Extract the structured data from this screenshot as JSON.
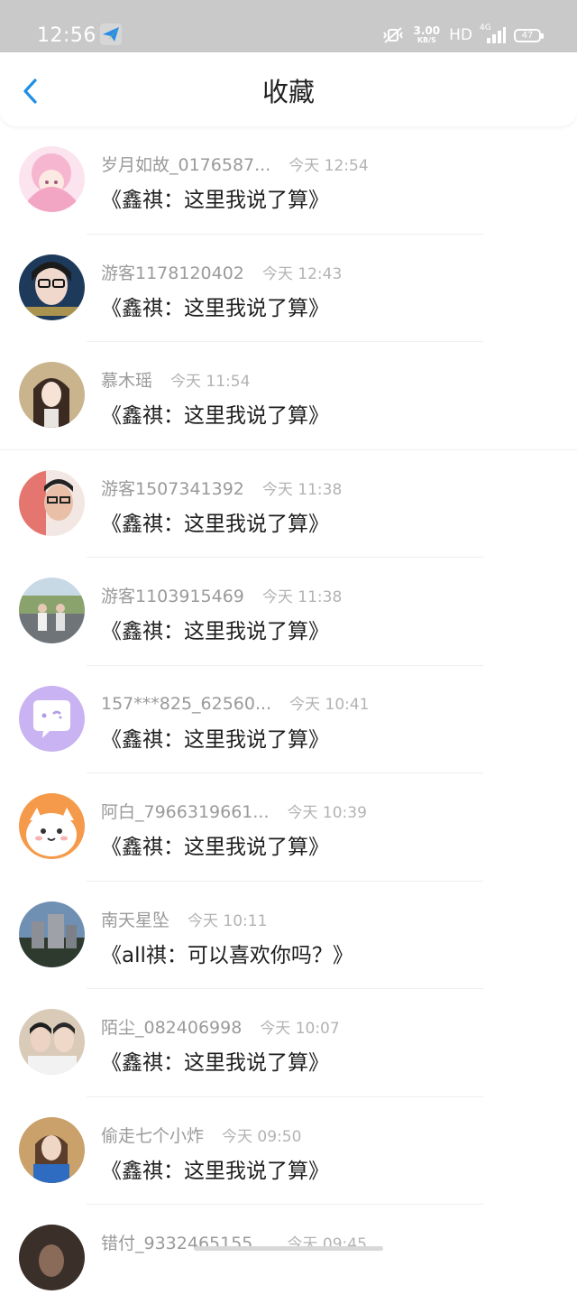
{
  "status": {
    "time": "12:56",
    "net_speed": "3.00",
    "net_unit": "KB/S",
    "hd": "HD",
    "network": "4G",
    "battery": "47"
  },
  "nav": {
    "title": "收藏"
  },
  "items": [
    {
      "name": "岁月如故_0176587...",
      "time": "今天 12:54",
      "title": "《鑫祺：这里我说了算》",
      "avatar": "pink-anime-girl"
    },
    {
      "name": "游客1178120402",
      "time": "今天 12:43",
      "title": "《鑫祺：这里我说了算》",
      "avatar": "glasses-girl"
    },
    {
      "name": "慕木瑶",
      "time": "今天 11:54",
      "title": "《鑫祺：这里我说了算》",
      "avatar": "anime-girl"
    },
    {
      "name": "游客1507341392",
      "time": "今天 11:38",
      "title": "《鑫祺：这里我说了算》",
      "avatar": "red-photo-boy"
    },
    {
      "name": "游客1103915469",
      "time": "今天 11:38",
      "title": "《鑫祺：这里我说了算》",
      "avatar": "street-couple"
    },
    {
      "name": "157***825_62560...",
      "time": "今天 10:41",
      "title": "《鑫祺：这里我说了算》",
      "avatar": "purple-chat-bubble"
    },
    {
      "name": "阿白_7966319661...",
      "time": "今天 10:39",
      "title": "《鑫祺：这里我说了算》",
      "avatar": "orange-cartoon-dog"
    },
    {
      "name": "南天星坠",
      "time": "今天 10:11",
      "title": "《all祺：可以喜欢你吗？》",
      "avatar": "city-buildings"
    },
    {
      "name": "陌尘_082406998",
      "time": "今天 10:07",
      "title": "《鑫祺：这里我说了算》",
      "avatar": "two-boys"
    },
    {
      "name": "偷走七个小炸",
      "time": "今天 09:50",
      "title": "《鑫祺：这里我说了算》",
      "avatar": "girl-blue-sweater"
    },
    {
      "name": "错付_9332465155...",
      "time": "今天 09:45",
      "title": "",
      "avatar": "dark-hair-person"
    }
  ]
}
